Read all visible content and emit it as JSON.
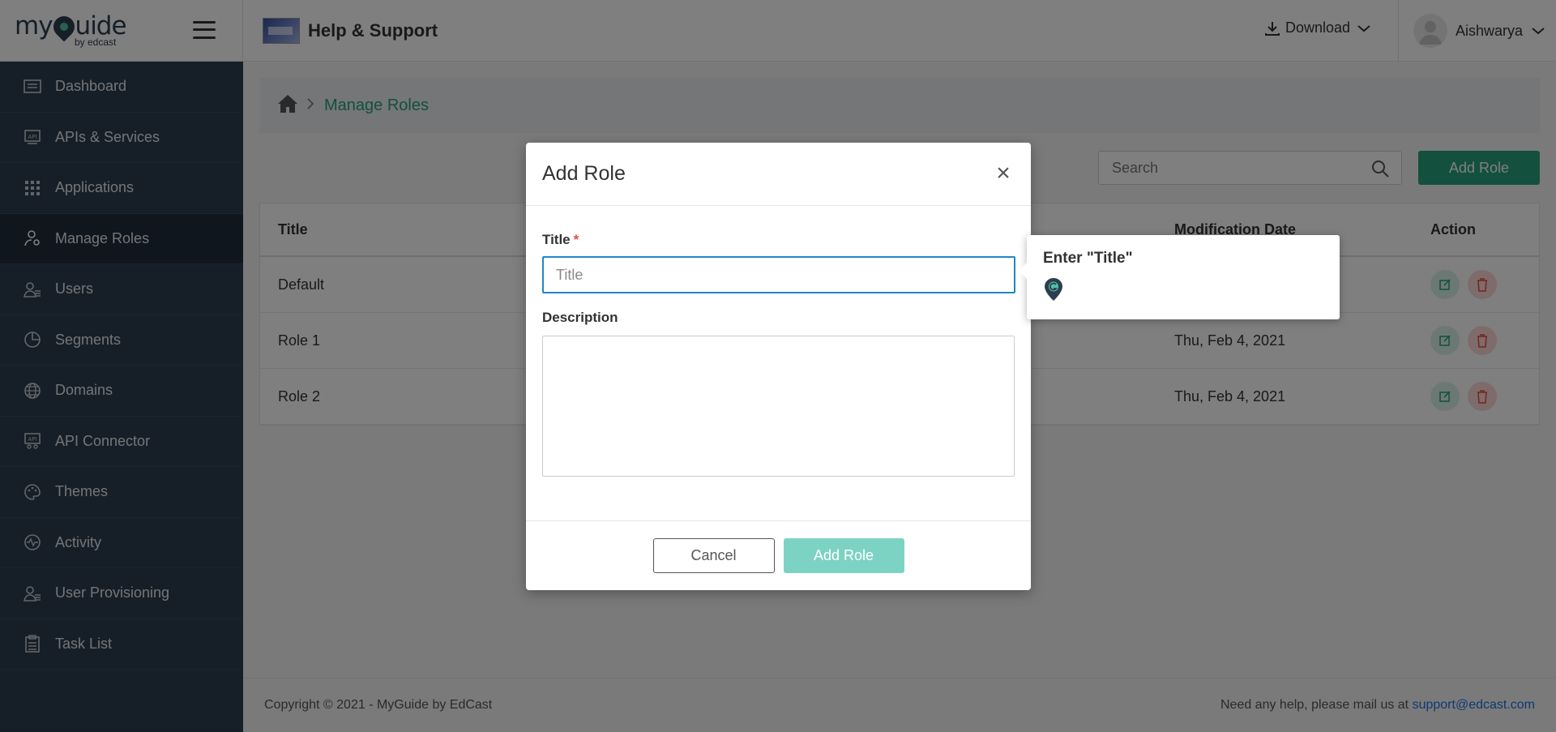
{
  "topbar": {
    "logo_text_main": "my",
    "logo_text_tail": "uide",
    "logo_sub": "by edcast",
    "page_title": "Help & Support",
    "download_label": "Download",
    "user_name": "Aishwarya"
  },
  "sidebar": {
    "items": [
      {
        "label": "Dashboard",
        "icon": "dashboard-icon",
        "active": false
      },
      {
        "label": "APIs & Services",
        "icon": "api-icon",
        "active": false
      },
      {
        "label": "Applications",
        "icon": "grid-icon",
        "active": false
      },
      {
        "label": "Manage Roles",
        "icon": "user-key-icon",
        "active": true
      },
      {
        "label": "Users",
        "icon": "users-icon",
        "active": false
      },
      {
        "label": "Segments",
        "icon": "pie-icon",
        "active": false
      },
      {
        "label": "Domains",
        "icon": "globe-icon",
        "active": false
      },
      {
        "label": "API Connector",
        "icon": "api-connector-icon",
        "active": false
      },
      {
        "label": "Themes",
        "icon": "palette-icon",
        "active": false
      },
      {
        "label": "Activity",
        "icon": "activity-icon",
        "active": false
      },
      {
        "label": "User Provisioning",
        "icon": "users-icon",
        "active": false
      },
      {
        "label": "Task List",
        "icon": "clipboard-icon",
        "active": false
      }
    ]
  },
  "breadcrumb": {
    "current": "Manage Roles"
  },
  "toolbar": {
    "search_placeholder": "Search",
    "add_role_label": "Add Role"
  },
  "table": {
    "headers": {
      "title": "Title",
      "modification_date": "Modification Date",
      "action": "Action"
    },
    "rows": [
      {
        "title": "Default",
        "date": ""
      },
      {
        "title": "Role 1",
        "date": "Thu, Feb 4, 2021"
      },
      {
        "title": "Role 2",
        "date": "Thu, Feb 4, 2021"
      }
    ]
  },
  "footer": {
    "copyright": "Copyright © 2021 - MyGuide by EdCast",
    "help_text": "Need any help, please mail us at",
    "help_email": "support@edcast.com"
  },
  "modal": {
    "title": "Add Role",
    "close_symbol": "×",
    "title_label": "Title",
    "required_mark": "*",
    "title_placeholder": "Title",
    "title_value": "",
    "description_label": "Description",
    "description_value": "",
    "cancel_label": "Cancel",
    "submit_label": "Add Role"
  },
  "tooltip": {
    "text": "Enter \"Title\""
  },
  "colors": {
    "brand_green": "#26a17b",
    "sidebar_bg": "#2c3e50",
    "focus_blue": "#1e88c7",
    "disabled_green": "#7dd3c3",
    "danger_red": "#e74c3c"
  }
}
